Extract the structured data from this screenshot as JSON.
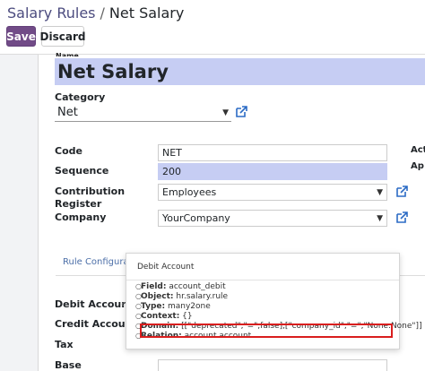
{
  "breadcrumb": {
    "parent": "Salary Rules",
    "separator": "/",
    "current": "Net Salary"
  },
  "toolbar": {
    "save_label": "Save",
    "discard_label": "Discard"
  },
  "form": {
    "name_label": "Name",
    "name_value": "Net Salary",
    "category_label": "Category",
    "category_value": "Net",
    "code_label": "Code",
    "code_value": "NET",
    "sequence_label": "Sequence",
    "sequence_value": "200",
    "contribution_label_1": "Contribution",
    "contribution_label_2": "Register",
    "contribution_value": "Employees",
    "company_label": "Company",
    "company_value": "YourCompany",
    "right_label_1": "Act",
    "right_label_2": "Ap"
  },
  "tabs": {
    "rule_config": "Rule Configurat"
  },
  "accounting": {
    "debit_label": "Debit Account",
    "credit_label": "Credit Account",
    "tax_label": "Tax",
    "base_label": "Base"
  },
  "tooltip": {
    "title": "Debit Account",
    "items": [
      {
        "key": "Field:",
        "value": " account_debit"
      },
      {
        "key": "Object:",
        "value": " hr.salary.rule"
      },
      {
        "key": "Type:",
        "value": " many2one"
      },
      {
        "key": "Context:",
        "value": " {}"
      },
      {
        "key": "Domain:",
        "value": " [[\"deprecated\",\"=\",false],[\"company_id\",\"=\",\"None.None\"]]"
      },
      {
        "key": "Relation:",
        "value": " account.account"
      }
    ]
  },
  "icons": {
    "caret": "caret-down-icon",
    "external": "external-link-icon"
  },
  "colors": {
    "primary": "#714b87",
    "highlight": "#c6cdf3",
    "annotation": "#d91e1e",
    "link": "#2b6bc5"
  }
}
